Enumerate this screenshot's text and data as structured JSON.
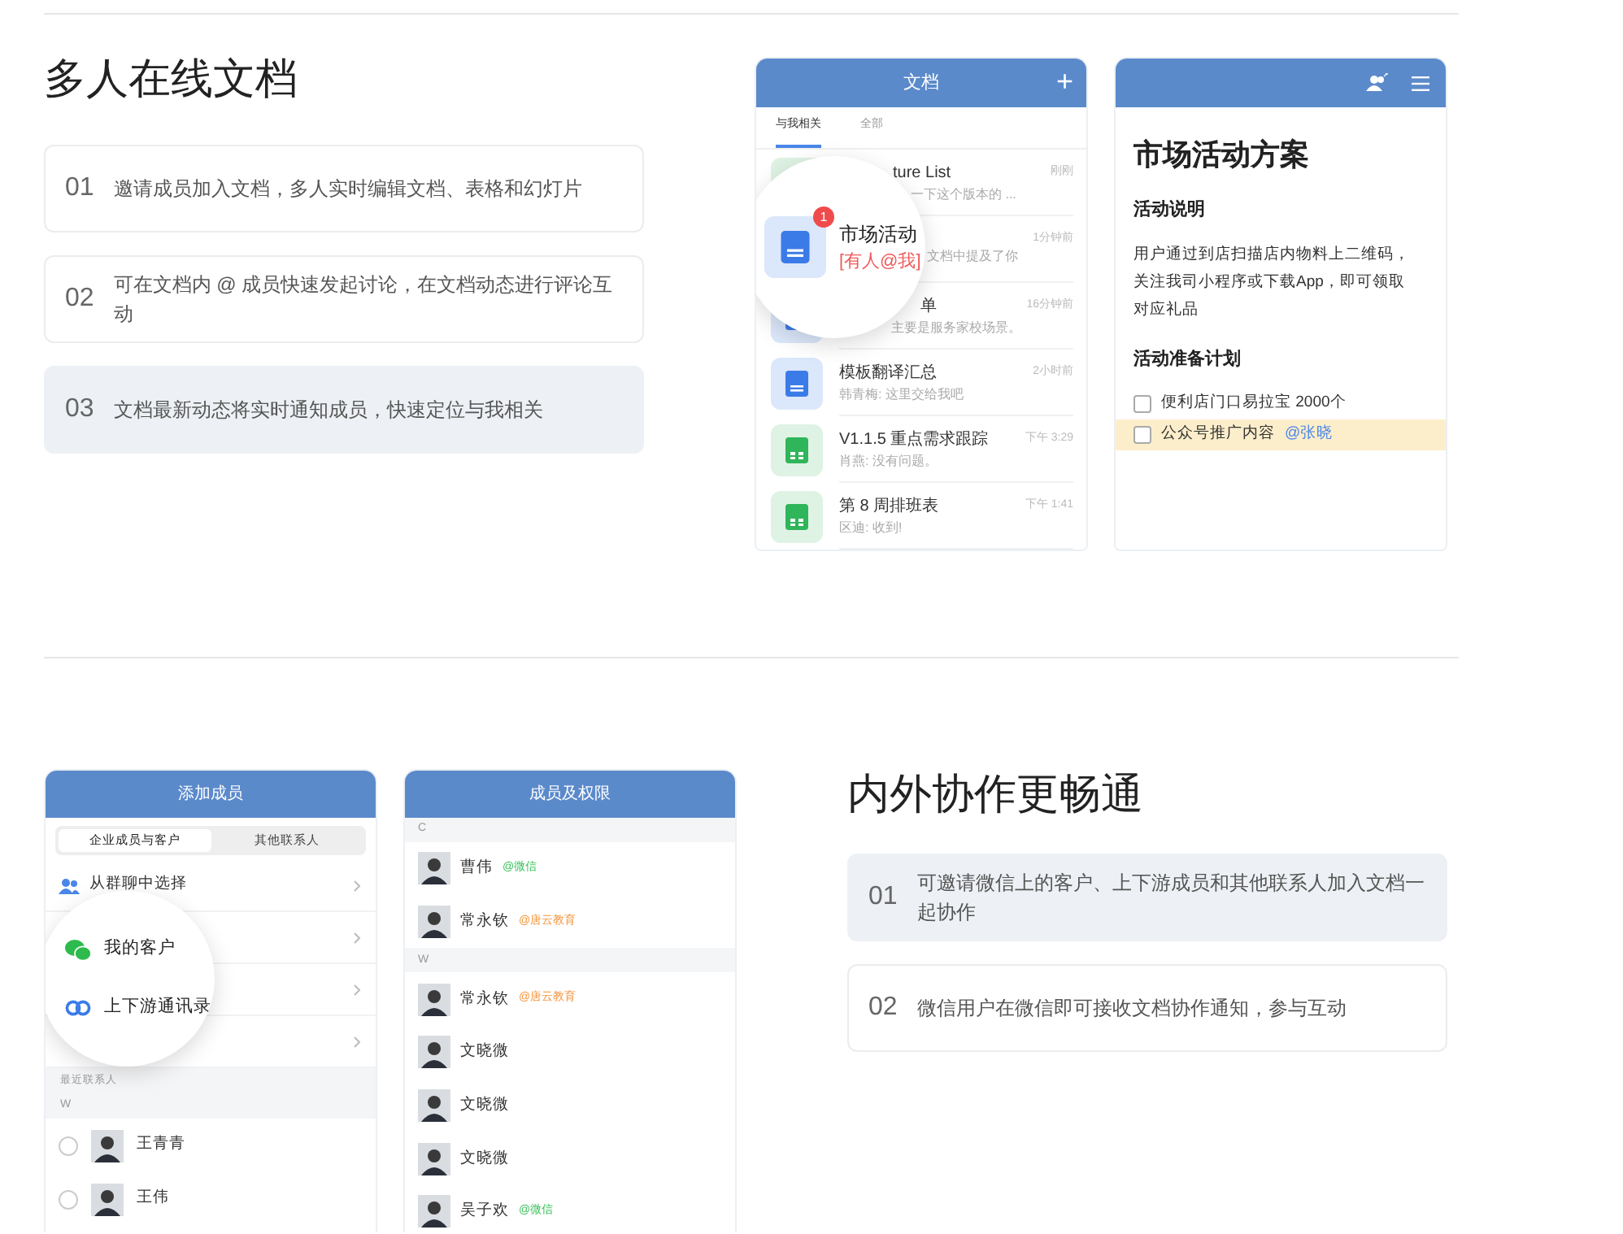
{
  "section_docs": {
    "title": "多人在线文档",
    "features": [
      {
        "number": "01",
        "text": "邀请成员加入文档，多人实时编辑文档、表格和幻灯片",
        "selected": false
      },
      {
        "number": "02",
        "text": "可在文档内 @ 成员快速发起讨论，在文档动态进行评论互动",
        "selected": false
      },
      {
        "number": "03",
        "text": "文档最新动态将实时通知成员，快速定位与我相关",
        "selected": true
      }
    ],
    "doc_list_phone": {
      "title": "文档",
      "add": "+",
      "tabs": [
        {
          "label": "与我相关",
          "selected": true
        },
        {
          "label": "全部",
          "selected": false
        }
      ],
      "items": [
        {
          "kind": "sheet",
          "title": "ture List",
          "subtitle": "一下这个版本的 ...",
          "time": "刚刚"
        },
        {
          "subtitle": "文档中提及了你",
          "time": "1分钟前"
        },
        {
          "kind": "doc",
          "title": "单",
          "subtitle": "主要是服务家校场景。",
          "time": "16分钟前"
        },
        {
          "kind": "doc",
          "title": "模板翻译汇总",
          "subtitle": "韩青梅: 这里交给我吧",
          "time": "2小时前"
        },
        {
          "kind": "sheet",
          "title": "V1.1.5 重点需求跟踪",
          "subtitle": "肖燕: 没有问题。",
          "time": "下午 3:29"
        },
        {
          "kind": "sheet",
          "title": "第 8 周排班表",
          "subtitle": "区迪: 收到!",
          "time": "下午 1:41"
        }
      ],
      "magnifier": {
        "kind": "doc",
        "title": "市场活动",
        "badge": "1",
        "tag": "[有人@我]"
      }
    },
    "doc_phone": {
      "title": "市场活动方案",
      "blocks": [
        {
          "kind": "heading",
          "text": "活动说明"
        },
        {
          "kind": "paragraph",
          "text": "用户通过到店扫描店内物料上二维码，关注我司小程序或下载App，即可领取对应礼品"
        },
        {
          "kind": "heading",
          "text": "活动准备计划"
        },
        {
          "kind": "todo",
          "text": "便利店门口易拉宝 2000个",
          "checked": false,
          "highlighted": false
        },
        {
          "kind": "todo",
          "text": "公众号推广内容",
          "mention": "@张晓",
          "checked": false,
          "highlighted": true
        }
      ]
    }
  },
  "section_collab": {
    "title": "内外协作更畅通",
    "features": [
      {
        "number": "01",
        "text": "可邀请微信上的客户、上下游成员和其他联系人加入文档一起协作",
        "selected": true
      },
      {
        "number": "02",
        "text": "微信用户在微信即可接收文档协作通知，参与互动",
        "selected": false
      }
    ],
    "add_member_phone": {
      "title": "添加成员",
      "tabs": [
        {
          "label": "企业成员与客户",
          "selected": true
        },
        {
          "label": "其他联系人",
          "selected": false
        }
      ],
      "rows": [
        {
          "kind": "group",
          "label": "从群聊中选择"
        },
        {
          "kind": "blank"
        },
        {
          "kind": "blank"
        },
        {
          "kind": "blank"
        }
      ],
      "magnifier": [
        {
          "kind": "wechat",
          "label": "我的客户"
        },
        {
          "kind": "link",
          "label": "上下游通讯录"
        }
      ],
      "recent_label": "最近联系人",
      "letter": "W",
      "contacts": [
        {
          "name": "王青青",
          "selected": false
        },
        {
          "name": "王伟",
          "selected": false
        }
      ]
    },
    "members_phone": {
      "title": "成员及权限",
      "groups": [
        {
          "letter": "C",
          "members": [
            {
              "name": "曹伟",
              "tag": "@微信",
              "color": "#3cc25b"
            },
            {
              "name": "常永钦",
              "tag": "@唐云教育",
              "color": "#f5953b"
            }
          ]
        },
        {
          "letter": "W",
          "members": [
            {
              "name": "常永钦",
              "tag": "@唐云教育",
              "color": "#f5953b"
            },
            {
              "name": "文晓微"
            },
            {
              "name": "文晓微"
            },
            {
              "name": "文晓微"
            },
            {
              "name": "吴子欢",
              "tag": "@微信",
              "color": "#3cc25b"
            }
          ]
        }
      ]
    }
  }
}
